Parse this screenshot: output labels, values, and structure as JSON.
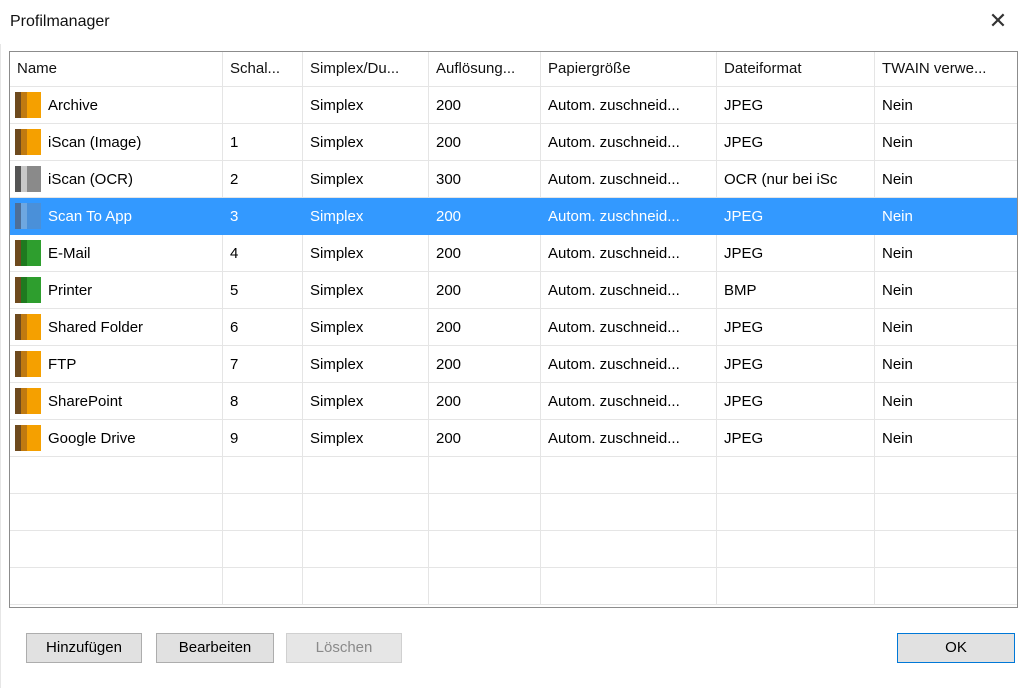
{
  "window": {
    "title": "Profilmanager",
    "close_glyph": "✕"
  },
  "table": {
    "columns": [
      "Name",
      "Schal...",
      "Simplex/Du...",
      "Auflösung...",
      "Papiergröße",
      "Dateiformat",
      "TWAIN verwe..."
    ],
    "rows": [
      {
        "name": "Archive",
        "button": "",
        "mode": "Simplex",
        "resolution": "200",
        "paper": "Autom. zuschneid...",
        "format": "JPEG",
        "twain": "Nein",
        "icon": "folder-orange-icon"
      },
      {
        "name": "iScan (Image)",
        "button": "1",
        "mode": "Simplex",
        "resolution": "200",
        "paper": "Autom. zuschneid...",
        "format": "JPEG",
        "twain": "Nein",
        "icon": "folder-orange-icon"
      },
      {
        "name": "iScan (OCR)",
        "button": "2",
        "mode": "Simplex",
        "resolution": "300",
        "paper": "Autom. zuschneid...",
        "format": "OCR (nur bei iSc",
        "twain": "Nein",
        "icon": "folder-gray-icon"
      },
      {
        "name": "Scan To App",
        "button": "3",
        "mode": "Simplex",
        "resolution": "200",
        "paper": "Autom. zuschneid...",
        "format": "JPEG",
        "twain": "Nein",
        "icon": "folder-blue-icon"
      },
      {
        "name": "E-Mail",
        "button": "4",
        "mode": "Simplex",
        "resolution": "200",
        "paper": "Autom. zuschneid...",
        "format": "JPEG",
        "twain": "Nein",
        "icon": "folder-green-icon"
      },
      {
        "name": "Printer",
        "button": "5",
        "mode": "Simplex",
        "resolution": "200",
        "paper": "Autom. zuschneid...",
        "format": "BMP",
        "twain": "Nein",
        "icon": "folder-green-icon"
      },
      {
        "name": "Shared Folder",
        "button": "6",
        "mode": "Simplex",
        "resolution": "200",
        "paper": "Autom. zuschneid...",
        "format": "JPEG",
        "twain": "Nein",
        "icon": "folder-orange-icon"
      },
      {
        "name": "FTP",
        "button": "7",
        "mode": "Simplex",
        "resolution": "200",
        "paper": "Autom. zuschneid...",
        "format": "JPEG",
        "twain": "Nein",
        "icon": "folder-orange-icon"
      },
      {
        "name": "SharePoint",
        "button": "8",
        "mode": "Simplex",
        "resolution": "200",
        "paper": "Autom. zuschneid...",
        "format": "JPEG",
        "twain": "Nein",
        "icon": "folder-orange-icon"
      },
      {
        "name": "Google Drive",
        "button": "9",
        "mode": "Simplex",
        "resolution": "200",
        "paper": "Autom. zuschneid...",
        "format": "JPEG",
        "twain": "Nein",
        "icon": "folder-orange-icon"
      }
    ],
    "selected_row": "Scan To App"
  },
  "buttons": {
    "add": "Hinzufügen",
    "edit": "Bearbeiten",
    "delete": "Löschen",
    "ok": "OK"
  },
  "colors": {
    "selection": "#3399ff",
    "orange_front": "#f5a000",
    "green_front": "#2e9e2e",
    "blue_front": "#4a90d9",
    "gray_front": "#8a8a8a",
    "page_back": "#6e4a1e"
  }
}
